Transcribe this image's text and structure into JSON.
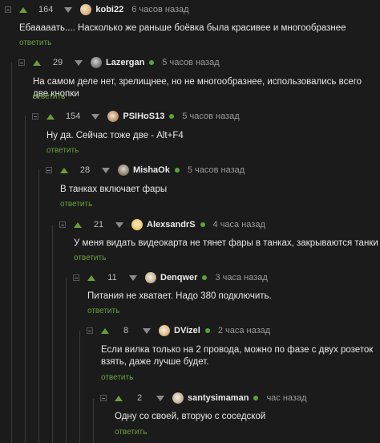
{
  "comments": [
    {
      "rating": "164",
      "user": "kobi22",
      "online": true,
      "time": "6 часов назад",
      "text": "Ебааааать.... Насколько же раньше боёвка была красивее и многообразнее",
      "reply": "ответить"
    },
    {
      "rating": "29",
      "user": "Lazergan",
      "online": true,
      "time": "5 часов назад",
      "text": "На самом деле нет, зрелищнее, но не многообразнее, использовались всего две кнопки",
      "reply": "ответить"
    },
    {
      "rating": "154",
      "user": "PSIHoS13",
      "online": true,
      "time": "5 часов назад",
      "text": "Ну да. Сейчас тоже две - Alt+F4",
      "reply": "ответить"
    },
    {
      "rating": "28",
      "user": "MishaOk",
      "online": true,
      "time": "5 часов назад",
      "text": "В танках включает фары",
      "reply": "ответить"
    },
    {
      "rating": "21",
      "user": "AlexsandrS",
      "online": true,
      "time": "4 часа назад",
      "text": "У меня видать видеокарта не тянет фары в танках, закрываются танки :)",
      "reply": "ответить"
    },
    {
      "rating": "11",
      "user": "Denqwer",
      "online": true,
      "time": "3 часа назад",
      "text": "Питания не хватает. Надо 380 подключить.",
      "reply": "ответить"
    },
    {
      "rating": "8",
      "user": "DVizel",
      "online": true,
      "time": "2 часа назад",
      "text": "Если вилка только на 2 провода, можно по фазе с двух розеток взять, даже лучше будет.",
      "reply": "ответить"
    },
    {
      "rating": "2",
      "user": "santysimaman",
      "online": true,
      "time": "час назад",
      "text": "Одну со своей, вторую с соседской",
      "reply": "ответить"
    }
  ],
  "colors": {
    "background": "#1b1b1b",
    "upvote": "#6a9e3a",
    "reply": "#6aa03c",
    "online": "#5aa33b"
  }
}
